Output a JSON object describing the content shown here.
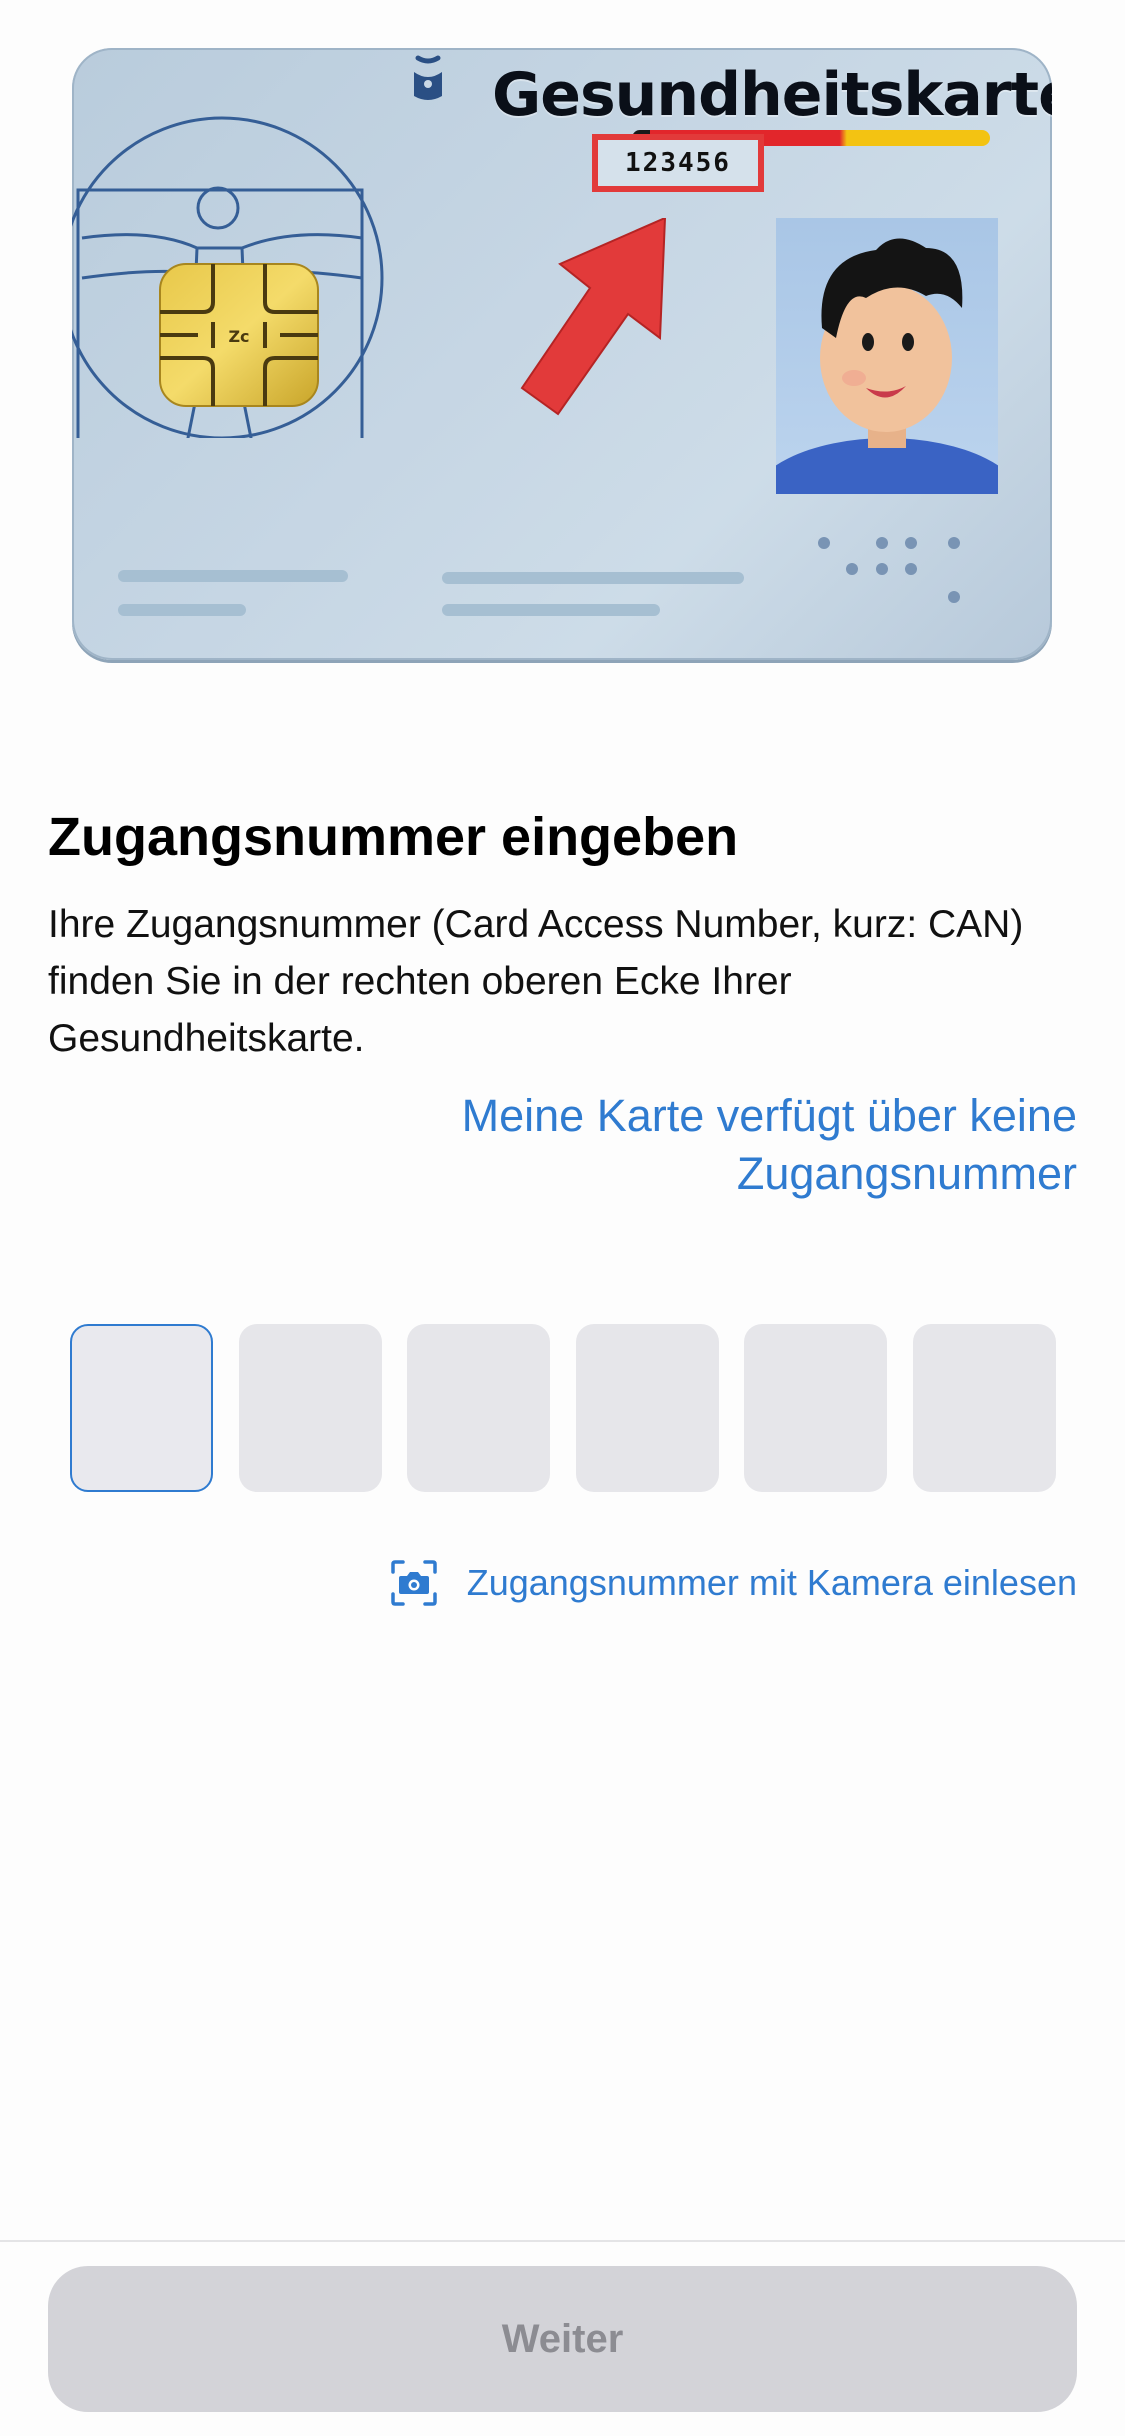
{
  "card": {
    "title": "Gesundheitskarte",
    "can_example": "123456",
    "colors": {
      "highlight": "#e23a3a",
      "flag_red": "#e2262b",
      "flag_gold": "#f3c312"
    }
  },
  "content": {
    "heading": "Zugangsnummer eingeben",
    "description": "Ihre Zugangsnummer (Card Access Number, kurz: CAN) finden Sie in der rechten oberen Ecke Ihrer Gesundheitskarte.",
    "no_can_link": "Meine Karte verfügt über keine Zugangsnummer"
  },
  "can_input": {
    "digits": [
      "",
      "",
      "",
      "",
      "",
      ""
    ],
    "active_index": 0
  },
  "camera": {
    "label": "Zugangsnummer mit Kamera einlesen",
    "icon": "camera-scan-icon"
  },
  "footer": {
    "next_label": "Weiter",
    "next_enabled": false
  },
  "colors": {
    "accent": "#2f7bd0",
    "input_bg": "#e6e6ea",
    "button_disabled_bg": "#d3d3d8",
    "button_disabled_text": "#8c8c92"
  }
}
